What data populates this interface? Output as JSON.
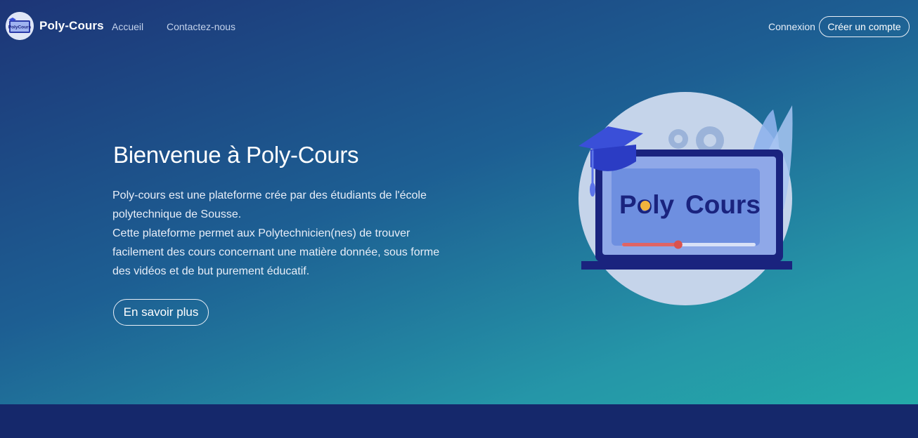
{
  "nav": {
    "logo_text": "PolyCours",
    "brand": "Poly-Cours",
    "links": [
      {
        "label": "Accueil"
      },
      {
        "label": "Contactez-nous"
      }
    ],
    "login": "Connexion",
    "signup": "Créer un compte"
  },
  "hero": {
    "title": "Bienvenue à Poly-Cours",
    "paragraph_lines": [
      "Poly-cours est une plateforme crée par des étudiants de l'école",
      "polytechnique de Sousse.",
      "Cette plateforme permet aux Polytechnicien(nes) de trouver",
      "facilement des cours concernant une matière donnée, sous forme",
      "des vidéos et  de but purement éducatif."
    ],
    "cta": "En savoir plus"
  },
  "illustration": {
    "screen_text_left": "Poly",
    "screen_text_right": "Cours",
    "video_progress": 0.42
  },
  "colors": {
    "hero_gradient_start": "#1d3577",
    "hero_gradient_end": "#24aaa9",
    "footer": "#15286b",
    "laptop_frame": "#1a237e",
    "screen": "#6e8fe0",
    "progress": "#e06464"
  }
}
